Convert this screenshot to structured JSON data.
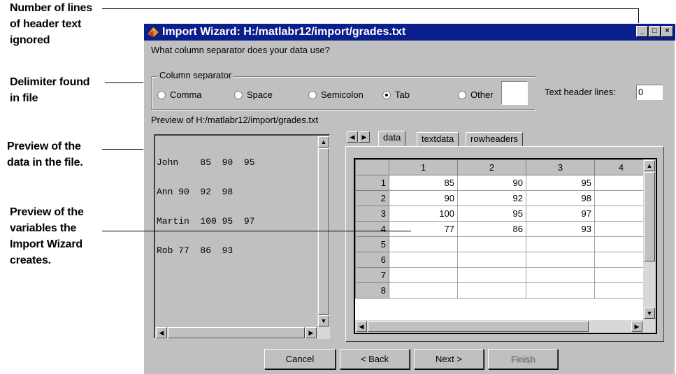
{
  "callouts": {
    "header_lines": [
      "Number of lines",
      "of header text",
      "ignored"
    ],
    "delimiter": [
      "Delimiter found",
      "in file"
    ],
    "data_preview": [
      "Preview of the",
      "data in the file."
    ],
    "variables_preview": [
      "Preview of the",
      "variables the",
      "Import Wizard",
      "creates."
    ]
  },
  "window": {
    "title": "Import Wizard: H:/matlabr12/import/grades.txt",
    "controls": {
      "minimize": "_",
      "maximize": "□",
      "close": "×"
    },
    "question": "What column separator does your data use?",
    "separator_group": {
      "label": "Column separator",
      "options": [
        "Comma",
        "Space",
        "Semicolon",
        "Tab",
        "Other"
      ],
      "selected": "Tab",
      "other_value": ""
    },
    "header_lines_label": "Text header lines:",
    "header_lines_value": "0",
    "preview_label": "Preview of H:/matlabr12/import/grades.txt",
    "preview_lines": [
      "John    85  90  95",
      "Ann 90  92  98",
      "Martin  100 95  97",
      "Rob 77  86  93"
    ],
    "tabs": [
      "data",
      "textdata",
      "rowheaders"
    ],
    "active_tab": "data",
    "grid": {
      "columns": [
        "1",
        "2",
        "3",
        "4"
      ],
      "rows": [
        {
          "h": "1",
          "cells": [
            "85",
            "90",
            "95",
            ""
          ]
        },
        {
          "h": "2",
          "cells": [
            "90",
            "92",
            "98",
            ""
          ]
        },
        {
          "h": "3",
          "cells": [
            "100",
            "95",
            "97",
            ""
          ]
        },
        {
          "h": "4",
          "cells": [
            "77",
            "86",
            "93",
            ""
          ]
        },
        {
          "h": "5",
          "cells": [
            "",
            "",
            "",
            ""
          ]
        },
        {
          "h": "6",
          "cells": [
            "",
            "",
            "",
            ""
          ]
        },
        {
          "h": "7",
          "cells": [
            "",
            "",
            "",
            ""
          ]
        },
        {
          "h": "8",
          "cells": [
            "",
            "",
            "",
            ""
          ]
        }
      ]
    },
    "buttons": {
      "cancel": "Cancel",
      "back": "< Back",
      "next": "Next >",
      "finish": "Finish"
    }
  }
}
